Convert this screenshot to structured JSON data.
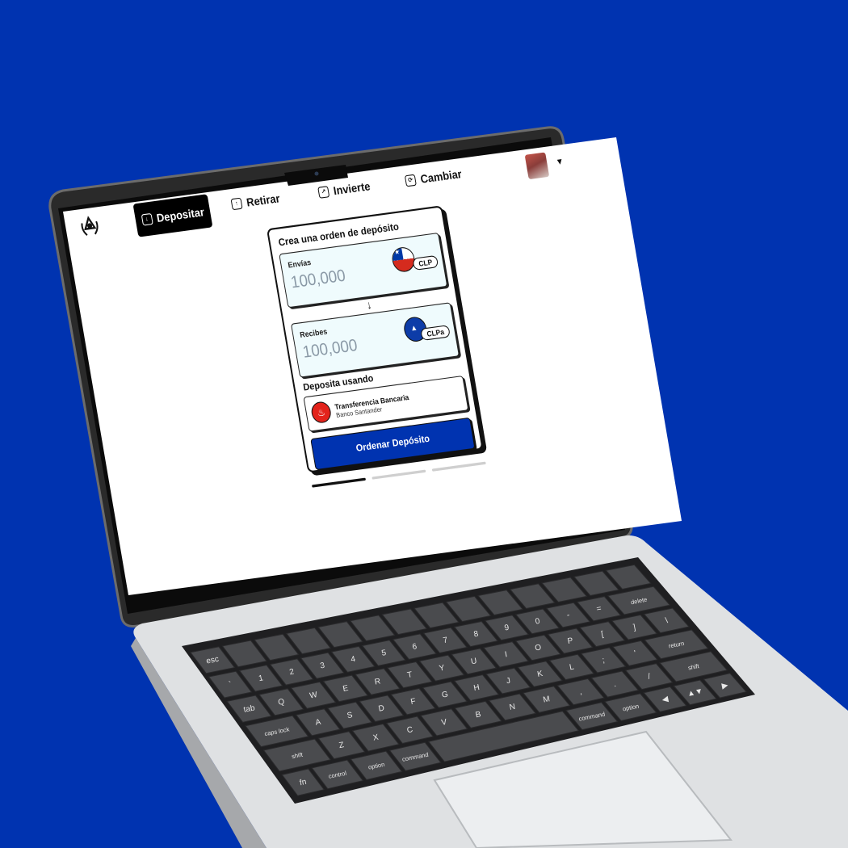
{
  "nav": {
    "items": [
      {
        "label": "Depositar",
        "icon": "download-icon",
        "active": true
      },
      {
        "label": "Retirar",
        "icon": "upload-icon"
      },
      {
        "label": "Invierte",
        "icon": "arrow-up-right-icon"
      },
      {
        "label": "Cambiar",
        "icon": "exchange-icon"
      }
    ],
    "avatar": "avatar",
    "avatar_caret": "▼",
    "logo": "laurel-mountain-logo"
  },
  "deposit": {
    "title": "Crea una orden de depósito",
    "send_label": "Envías",
    "send_value": "100,000",
    "send_currency": "CLP",
    "receive_label": "Recibes",
    "receive_value": "100,000",
    "receive_currency": "CLPa",
    "method_title": "Deposita usando",
    "method_name": "Transferencia Bancaria",
    "method_bank": "Banco Santander",
    "submit_label": "Ordenar Depósito",
    "steps_total": 3,
    "step_current": 1
  },
  "colors": {
    "background": "#0033b0",
    "accent": "#0033b0",
    "bank_red": "#e3231b"
  },
  "keyboard": {
    "fn_row": [
      "esc",
      "",
      "",
      "",
      "",
      "",
      "",
      "",
      "",
      "",
      "",
      "",
      "",
      ""
    ],
    "row1": [
      "~\n`",
      "!\n1",
      "@\n2",
      "#\n3",
      "$\n4",
      "%\n5",
      "^\n6",
      "&\n7",
      "*\n8",
      "(\n9",
      ")\n0",
      "—\n-",
      "+\n=",
      "delete"
    ],
    "row2": [
      "tab",
      "Q",
      "W",
      "E",
      "R",
      "T",
      "Y",
      "U",
      "I",
      "O",
      "P",
      "{\n[",
      "}\n]",
      "|\n\\"
    ],
    "row3": [
      "caps lock",
      "A",
      "S",
      "D",
      "F",
      "G",
      "H",
      "J",
      "K",
      "L",
      ":\n;",
      "\"\n'",
      "return"
    ],
    "row4": [
      "shift",
      "Z",
      "X",
      "C",
      "V",
      "B",
      "N",
      "M",
      "<\n,",
      ">\n.",
      "?\n/",
      "shift"
    ],
    "row5": [
      "fn",
      "control",
      "option",
      "command",
      "",
      "command",
      "option",
      "◀",
      "▲▼",
      "▶"
    ]
  }
}
